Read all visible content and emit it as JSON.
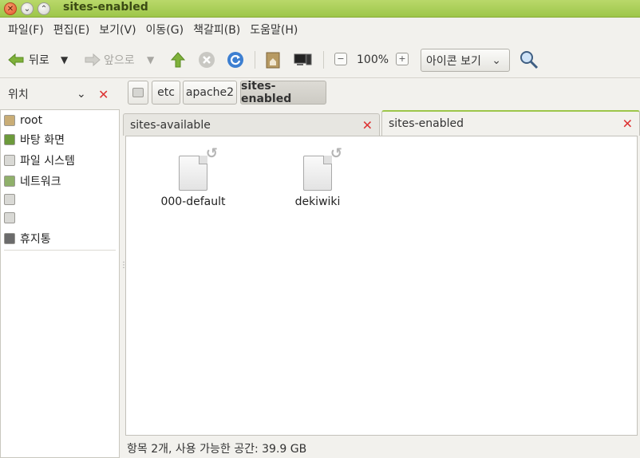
{
  "window": {
    "title": "sites-enabled"
  },
  "menu": {
    "items": [
      "파일(F)",
      "편집(E)",
      "보기(V)",
      "이동(G)",
      "책갈피(B)",
      "도움말(H)"
    ]
  },
  "toolbar": {
    "back_label": "뒤로",
    "forward_label": "앞으로",
    "zoom_level": "100%",
    "view_mode": "아이콘 보기",
    "zoom_out_symbol": "−",
    "zoom_in_symbol": "+"
  },
  "sidebar": {
    "header": "위치",
    "items": [
      {
        "label": "root",
        "icon": "home-folder-icon"
      },
      {
        "label": "바탕 화면",
        "icon": "desktop-icon"
      },
      {
        "label": "파일 시스템",
        "icon": "drive-icon"
      },
      {
        "label": "네트워크",
        "icon": "network-icon"
      },
      {
        "label": "",
        "icon": "drive-icon"
      },
      {
        "label": "",
        "icon": "drive-icon"
      },
      {
        "label": "휴지통",
        "icon": "trash-icon"
      }
    ]
  },
  "pathbar": {
    "crumbs": [
      "etc",
      "apache2",
      "sites-enabled"
    ]
  },
  "tabs": [
    {
      "label": "sites-available",
      "active": false
    },
    {
      "label": "sites-enabled",
      "active": true
    }
  ],
  "files": [
    {
      "name": "000-default",
      "icon": "symlink-file-icon"
    },
    {
      "name": "dekiwiki",
      "icon": "symlink-file-icon"
    }
  ],
  "status": {
    "text": "항목 2개, 사용 가능한 공간: 39.9 GB"
  },
  "colors": {
    "accent": "#9dc64a",
    "close_red": "#dd3333"
  }
}
